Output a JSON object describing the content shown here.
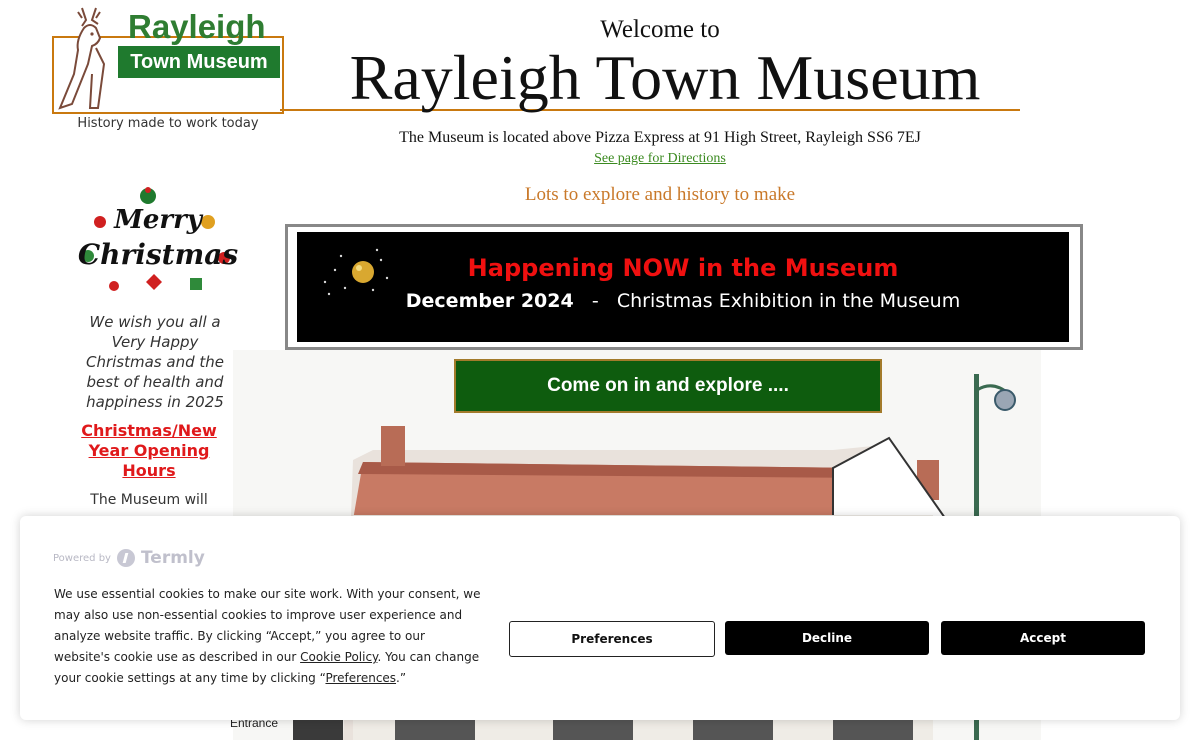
{
  "header": {
    "logo_word": "Rayleigh",
    "logo_band": "Town Museum",
    "tagline": "History made to work today",
    "welcome": "Welcome to",
    "title": "Rayleigh Town Museum",
    "address": "The Museum is located above Pizza Express at 91 High Street, Rayleigh SS6 7EJ",
    "directions_link": "See page for Directions",
    "explore_text": "Lots to explore and history to make"
  },
  "sidebar": {
    "xmas_line1": "Merry",
    "xmas_line2": "Christmas",
    "wish": "We wish you all a  Very Happy Christmas and the best of health and happiness in 2025",
    "hours_link": "Christmas/New Year Opening Hours",
    "museum_will": "The Museum will"
  },
  "banner": {
    "headline": "Happening NOW in the Museum",
    "date": "December 2024",
    "separator": "-",
    "event": "Christmas Exhibition in the Museum"
  },
  "main": {
    "cta_label": "Come on in and explore ....",
    "entrance_label": "Entrance"
  },
  "cookie": {
    "powered_by": "Powered by",
    "brand": "Termly",
    "text_part1": "We use essential cookies to make our site work. With your consent, we may also use non-essential cookies to improve user experience and analyze website traffic. By clicking “Accept,” you agree to our website's cookie use as described in our ",
    "cookie_policy_link": "Cookie Policy",
    "text_part2": ". You can change your cookie settings at any time by clicking “",
    "preferences_link": "Preferences",
    "text_part3": ".”",
    "btn_preferences": "Preferences",
    "btn_decline": "Decline",
    "btn_accept": "Accept"
  },
  "colors": {
    "brand_green": "#1f7a2e",
    "accent_orange": "#c9790f",
    "alert_red": "#f01010",
    "cta_green": "#0e5c0e"
  }
}
